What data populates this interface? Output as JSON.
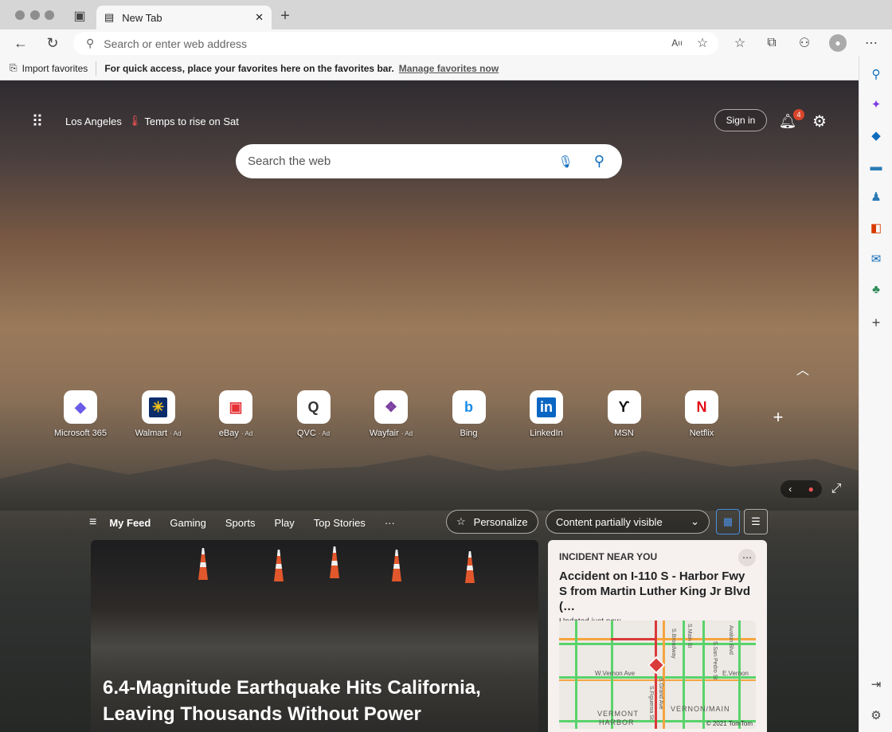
{
  "browser": {
    "tab_title": "New Tab",
    "address_placeholder": "Search or enter web address"
  },
  "favorites_bar": {
    "import_label": "Import favorites",
    "message": "For quick access, place your favorites here on the favorites bar.",
    "manage_link": "Manage favorites now"
  },
  "header": {
    "location": "Los Angeles",
    "weather_text": "Temps to rise on Sat",
    "sign_in": "Sign in",
    "notification_count": "4"
  },
  "search": {
    "placeholder": "Search the web"
  },
  "quick_links": [
    {
      "label": "Microsoft 365",
      "ad": "",
      "icon": "microsoft-365-icon"
    },
    {
      "label": "Walmart",
      "ad": "· Ad",
      "icon": "walmart-icon"
    },
    {
      "label": "eBay",
      "ad": "· Ad",
      "icon": "ebay-icon"
    },
    {
      "label": "QVC",
      "ad": "· Ad",
      "icon": "qvc-icon"
    },
    {
      "label": "Wayfair",
      "ad": "· Ad",
      "icon": "wayfair-icon"
    },
    {
      "label": "Bing",
      "ad": "",
      "icon": "bing-icon"
    },
    {
      "label": "LinkedIn",
      "ad": "",
      "icon": "linkedin-icon"
    },
    {
      "label": "MSN",
      "ad": "",
      "icon": "msn-icon"
    },
    {
      "label": "Netflix",
      "ad": "",
      "icon": "netflix-icon"
    }
  ],
  "feed": {
    "tabs": [
      "My Feed",
      "Gaming",
      "Sports",
      "Play",
      "Top Stories"
    ],
    "more": "···",
    "personalize": "Personalize",
    "visibility": "Content partially visible"
  },
  "hero": {
    "headline": "6.4-Magnitude Earthquake Hits California, Leaving Thousands Without Power"
  },
  "incident": {
    "label": "INCIDENT NEAR YOU",
    "title": "Accident on I-110 S - Harbor Fwy S from Martin Luther King Jr Blvd (…",
    "updated": "Updated just now",
    "map_labels": [
      "W.Vernon Ave",
      "E.Vernon",
      "S.Broadway",
      "S.Main St",
      "S.San Pedro St",
      "Avalon Blvd",
      "S.Figueroa St",
      "S.Grand Ave",
      "VERMONT",
      "HARBOR",
      "VERNON/MAIN"
    ],
    "copyright": "© 2021 TomTom"
  },
  "colors": {
    "accent": "#0f6cbd",
    "traffic_green": "#5ad36b",
    "traffic_orange": "#f5a440",
    "traffic_red": "#d93a3a"
  }
}
